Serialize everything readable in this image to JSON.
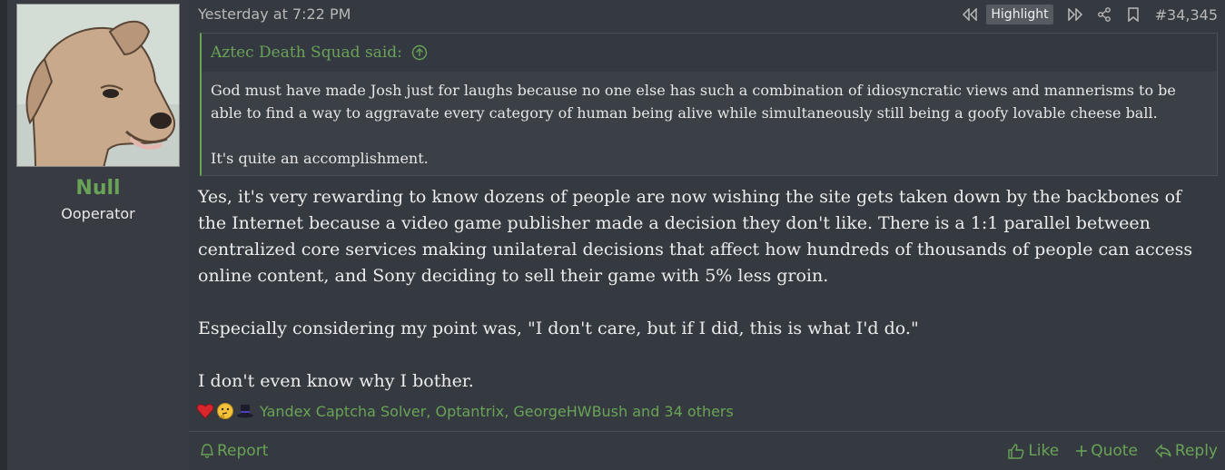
{
  "user": {
    "name": "Null",
    "title": "Ooperator"
  },
  "post": {
    "date": "Yesterday at 7:22 PM",
    "highlight_label": "Highlight",
    "number": "#34,345"
  },
  "quote": {
    "author": "Aztec Death Squad said:",
    "paragraphs": [
      "God must have made Josh just for laughs because no one else has such a combination of idiosyncratic views and mannerisms to be able to find a way to aggravate every category of human being alive while simultaneously still being a goofy lovable cheese ball.",
      "It's quite an accomplishment."
    ]
  },
  "body": {
    "paragraphs": [
      "Yes, it's very rewarding to know dozens of people are now wishing the site gets taken down by the backbones of the Internet because a video game publisher made a decision they don't like. There is a 1:1 parallel between centralized core services making unilateral decisions that affect how hundreds of thousands of people can access online content, and Sony deciding to sell their game with 5% less groin.",
      "Especially considering my point was, \"I don't care, but if I did, this is what I'd do.\"",
      "I don't even know why I bother."
    ]
  },
  "reactions": {
    "icons": [
      "heart-icon",
      "thinking-face-icon",
      "top-hat-icon"
    ],
    "text": "Yandex Captcha Solver, Optantrix, GeorgeHWBush and 34 others"
  },
  "footer": {
    "report": "Report",
    "like": "Like",
    "quote": "Quote",
    "reply": "Reply"
  },
  "colors": {
    "accent": "#69a357",
    "background": "#353a40",
    "sidebar": "#383c42"
  }
}
